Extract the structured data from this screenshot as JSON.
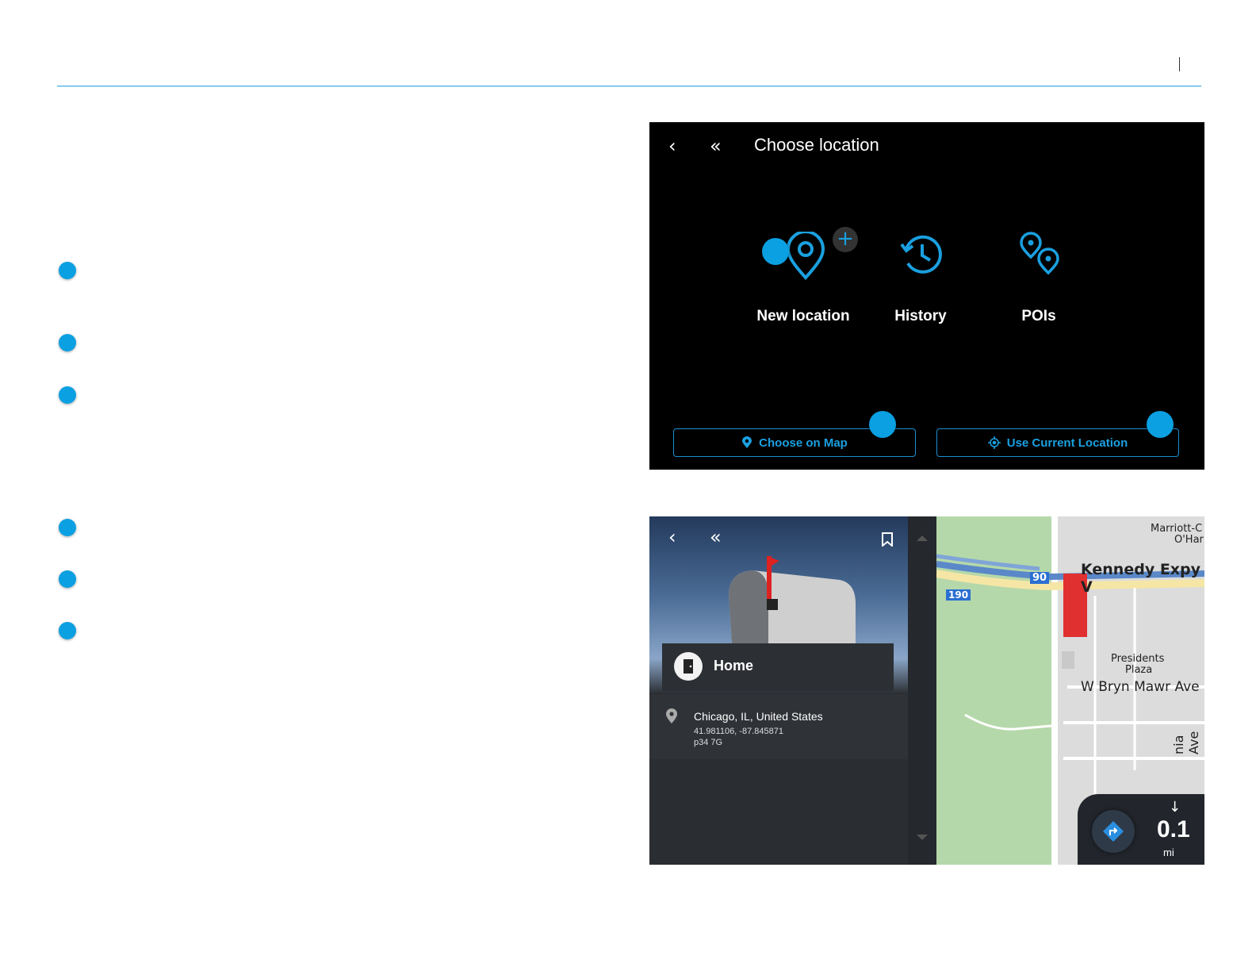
{
  "screenshot_1": {
    "title": "Choose location",
    "options": [
      {
        "label": "New location",
        "icon": "location-pin-add-icon"
      },
      {
        "label": "History",
        "icon": "history-icon"
      },
      {
        "label": "POIs",
        "icon": "pois-icon"
      }
    ],
    "choose_on_map_label": "Choose on Map",
    "use_current_location_label": "Use Current Location"
  },
  "screenshot_2": {
    "place_title": "Home",
    "address": "Chicago, IL, United States",
    "coordinates": "41.981106, -87.845871",
    "code": "p34 7G",
    "map_labels": {
      "hotel": "Marriott-C",
      "hotel_line2": "O'Har",
      "expressway": "Kennedy Expy V",
      "shield_90": "90",
      "shield_190": "190",
      "plaza": "Presidents",
      "plaza_line2": "Plaza",
      "street": "W Bryn Mawr Ave",
      "vertical_street": "nia Ave"
    },
    "distance_value": "0.1",
    "distance_unit": "mi"
  },
  "colors": {
    "accent": "#0aa0e2",
    "screen_bg": "#000000",
    "panel_bg": "#2a2d31"
  }
}
